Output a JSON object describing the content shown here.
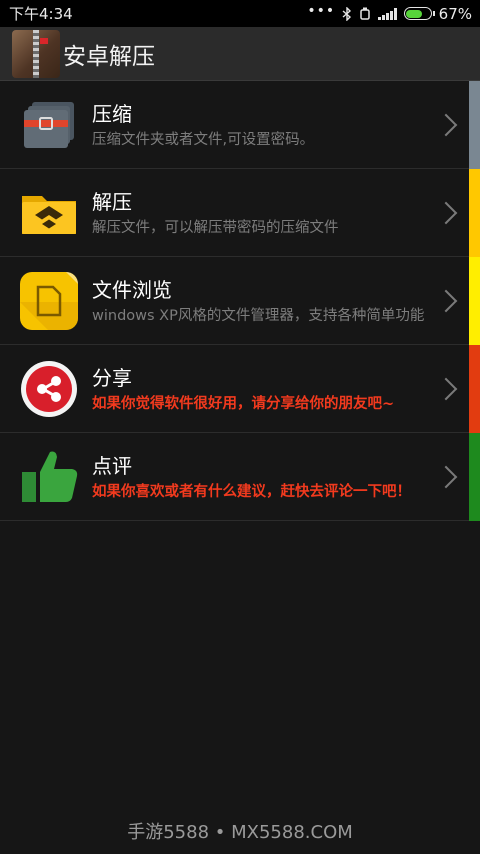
{
  "status": {
    "time": "下午4:34",
    "battery": "67%"
  },
  "app": {
    "title": "安卓解压"
  },
  "items": [
    {
      "title": "压缩",
      "subtitle": "压缩文件夹或者文件,可设置密码。",
      "accent": "#7a8792"
    },
    {
      "title": "解压",
      "subtitle": "解压文件，可以解压带密码的压缩文件",
      "accent": "#ffc800"
    },
    {
      "title": "文件浏览",
      "subtitle": "windows XP风格的文件管理器，支持各种简单功能",
      "accent": "#ffee00"
    },
    {
      "title": "分享",
      "subtitle": "如果你觉得软件很好用，请分享给你的朋友吧~",
      "accent": "#e23c10"
    },
    {
      "title": "点评",
      "subtitle": "如果你喜欢或者有什么建议，赶快去评论一下吧！",
      "accent": "#1e8a1e"
    }
  ],
  "footer": {
    "watermark": "手游5588 • MX5588.COM"
  }
}
